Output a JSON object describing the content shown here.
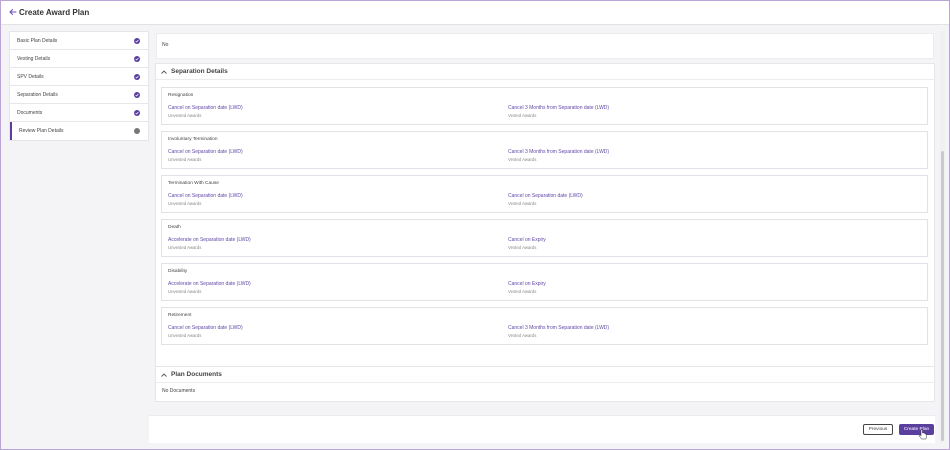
{
  "header": {
    "title": "Create Award Plan"
  },
  "sidebar": {
    "items": [
      {
        "label": "Basic Plan Details",
        "status": "complete"
      },
      {
        "label": "Vesting Details",
        "status": "complete"
      },
      {
        "label": "SPV Details",
        "status": "complete"
      },
      {
        "label": "Separation Details",
        "status": "complete"
      },
      {
        "label": "Documents",
        "status": "complete"
      },
      {
        "label": "Review Plan Details",
        "status": "current"
      }
    ]
  },
  "top_panel": {
    "value": "No"
  },
  "separation": {
    "title": "Separation Details",
    "unvested_label": "Unvested Awards",
    "vested_label": "Vested Awards",
    "rows": [
      {
        "title": "Resignation",
        "unvested": "Cancel on Separation date (LWD)",
        "vested": "Cancel 3 Months from Separation date (LWD)"
      },
      {
        "title": "Involuntary Termination",
        "unvested": "Cancel on Separation date (LWD)",
        "vested": "Cancel 3 Months from Separation date (LWD)"
      },
      {
        "title": "Termination With Cause",
        "unvested": "Cancel on Separation date (LWD)",
        "vested": "Cancel on Separation date (LWD)"
      },
      {
        "title": "Death",
        "unvested": "Accelerate on Separation date (LWD)",
        "vested": "Cancel on Expiry"
      },
      {
        "title": "Disability",
        "unvested": "Accelerate on Separation date (LWD)",
        "vested": "Cancel on Expiry"
      },
      {
        "title": "Retirement",
        "unvested": "Cancel on Separation date (LWD)",
        "vested": "Cancel 3 Months from Separation date (LWD)"
      }
    ]
  },
  "documents": {
    "title": "Plan Documents",
    "empty_text": "No Documents"
  },
  "footer": {
    "previous_label": "Previous",
    "create_label": "Create Plan"
  },
  "colors": {
    "accent": "#5b3f9e",
    "link": "#6048a8"
  }
}
